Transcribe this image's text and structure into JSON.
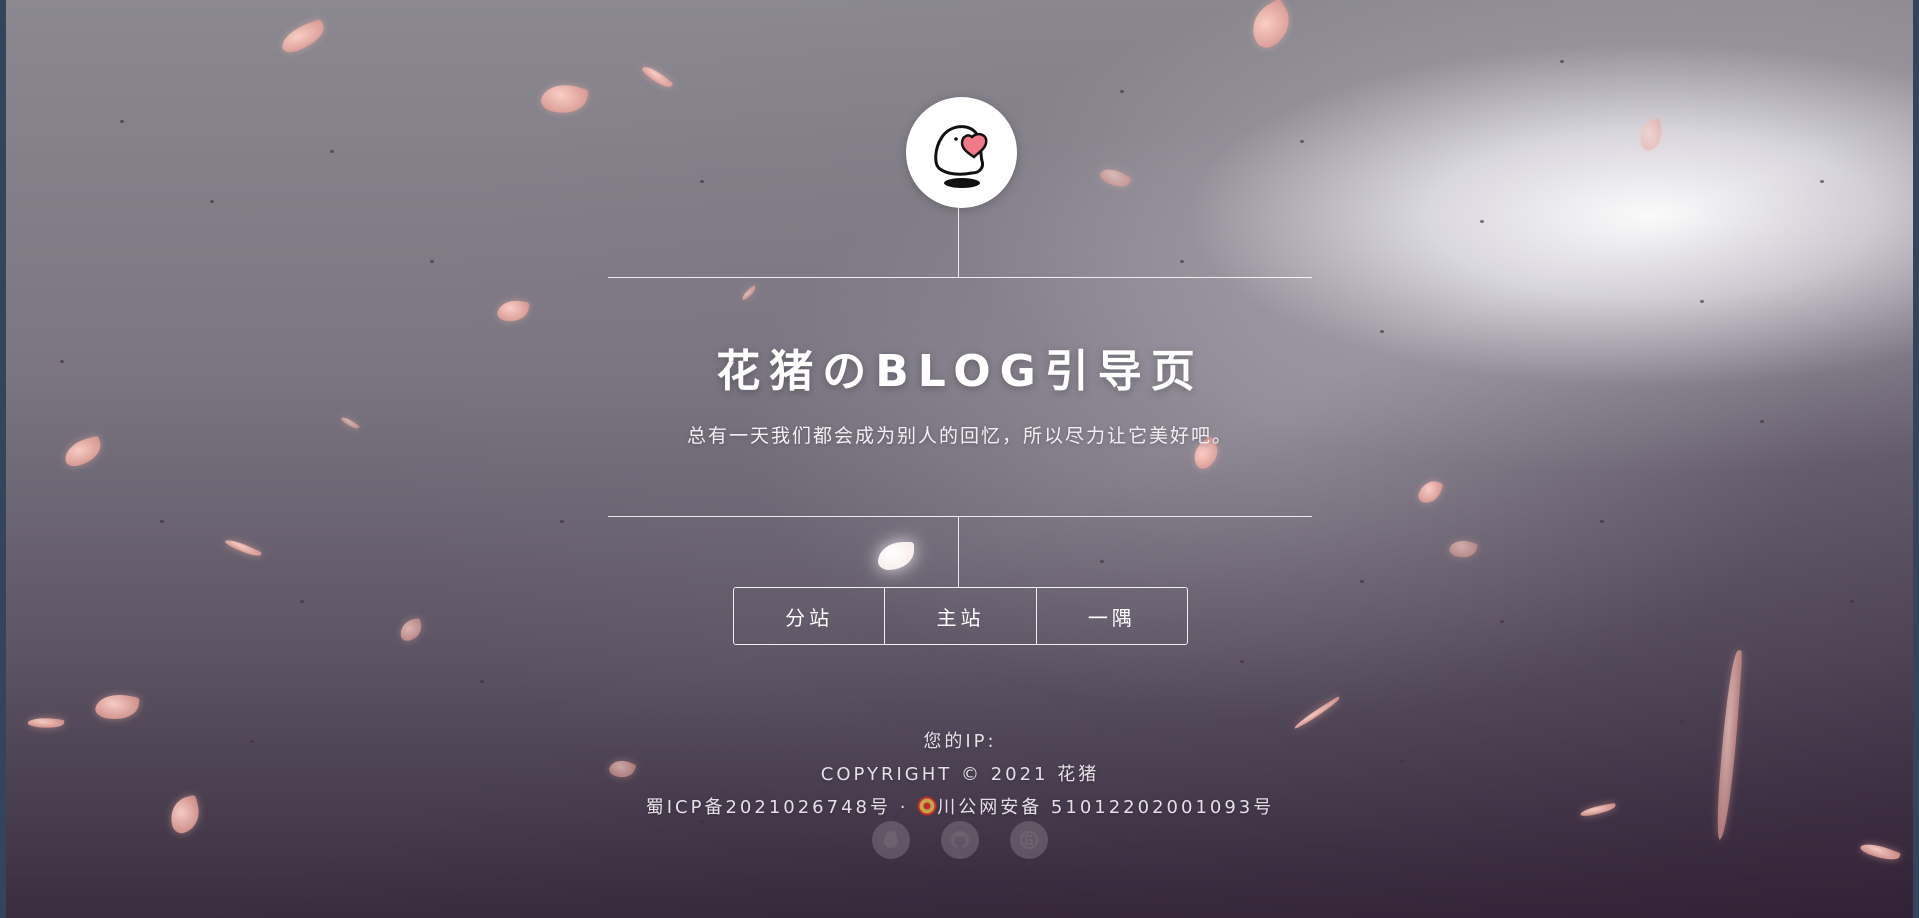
{
  "header": {
    "avatar_icon": "ghost-with-heart-icon"
  },
  "main": {
    "title": "花猪のBLOG引导页",
    "subtitle": "总有一天我们都会成为别人的回忆，所以尽力让它美好吧。",
    "nav": [
      {
        "label": "分站"
      },
      {
        "label": "主站"
      },
      {
        "label": "一隅"
      }
    ]
  },
  "footer": {
    "ip_label": "您的IP:",
    "copyright": "COPYRIGHT © 2021 花猪",
    "icp": "蜀ICP备2021026748号",
    "separator": "·",
    "police_record": "川公网安备 51012202001093号",
    "social": [
      {
        "icon": "qq-icon"
      },
      {
        "icon": "github-icon"
      },
      {
        "icon": "blog-icon"
      }
    ]
  },
  "colors": {
    "text": "#ffffff",
    "edge": "#34445a",
    "petal": "#f2b0a8",
    "heart": "#f07a8a"
  }
}
